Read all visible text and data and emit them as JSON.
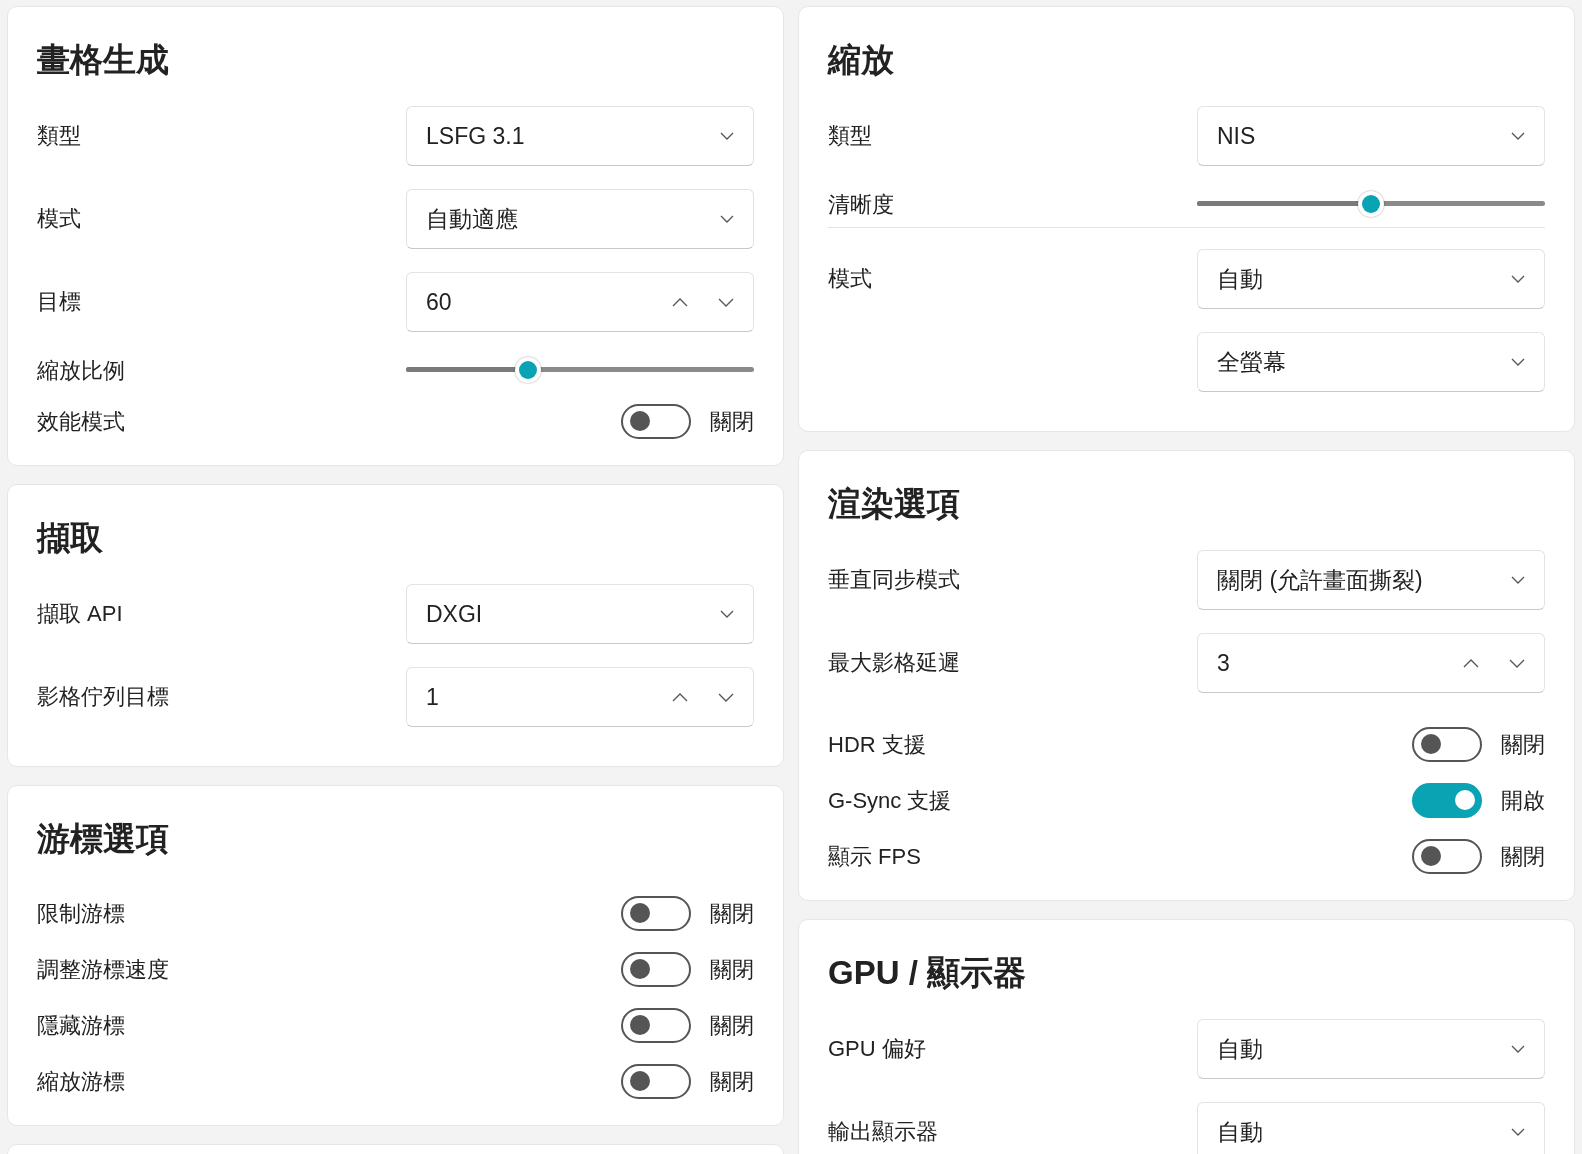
{
  "columns": [
    {
      "cards": [
        {
          "title": "畫格生成",
          "rows": [
            {
              "kind": "dropdown",
              "label": "類型",
              "value": "LSFG 3.1"
            },
            {
              "kind": "dropdown",
              "label": "模式",
              "value": "自動適應"
            },
            {
              "kind": "spinner",
              "label": "目標",
              "value": "60"
            },
            {
              "kind": "slider",
              "label": "縮放比例",
              "level": 0.35
            },
            {
              "kind": "toggle",
              "label": "效能模式",
              "on": false,
              "state": "關閉"
            }
          ]
        },
        {
          "title": "擷取",
          "rows": [
            {
              "kind": "dropdown",
              "label": "擷取 API",
              "value": "DXGI"
            },
            {
              "kind": "spinner",
              "label": "影格佇列目標",
              "value": "1"
            }
          ]
        },
        {
          "title": "游標選項",
          "rows": [
            {
              "kind": "toggle",
              "label": "限制游標",
              "on": false,
              "state": "關閉"
            },
            {
              "kind": "toggle",
              "label": "調整游標速度",
              "on": false,
              "state": "關閉"
            },
            {
              "kind": "toggle",
              "label": "隱藏游標",
              "on": false,
              "state": "關閉"
            },
            {
              "kind": "toggle",
              "label": "縮放游標",
              "on": false,
              "state": "關閉"
            }
          ]
        }
      ]
    },
    {
      "cards": [
        {
          "title": "縮放",
          "rows": [
            {
              "kind": "dropdown",
              "label": "類型",
              "value": "NIS"
            },
            {
              "kind": "slider",
              "label": "清晰度",
              "level": 0.5
            },
            {
              "kind": "divider"
            },
            {
              "kind": "dropdown",
              "label": "模式",
              "value": "自動"
            },
            {
              "kind": "dropdown",
              "value": "全螢幕"
            }
          ]
        },
        {
          "title": "渲染選項",
          "rows": [
            {
              "kind": "dropdown",
              "label": "垂直同步模式",
              "value": "關閉 (允許畫面撕裂)"
            },
            {
              "kind": "spinner",
              "label": "最大影格延遲",
              "value": "3"
            },
            {
              "kind": "toggle",
              "label": "HDR 支援",
              "on": false,
              "state": "關閉"
            },
            {
              "kind": "toggle",
              "label": "G-Sync 支援",
              "on": true,
              "state": "開啟"
            },
            {
              "kind": "toggle",
              "label": "顯示 FPS",
              "on": false,
              "state": "關閉"
            }
          ]
        },
        {
          "title": "GPU / 顯示器",
          "rows": [
            {
              "kind": "dropdown",
              "label": "GPU 偏好",
              "value": "自動"
            },
            {
              "kind": "dropdown",
              "label": "輸出顯示器",
              "value": "自動"
            }
          ]
        }
      ]
    }
  ]
}
